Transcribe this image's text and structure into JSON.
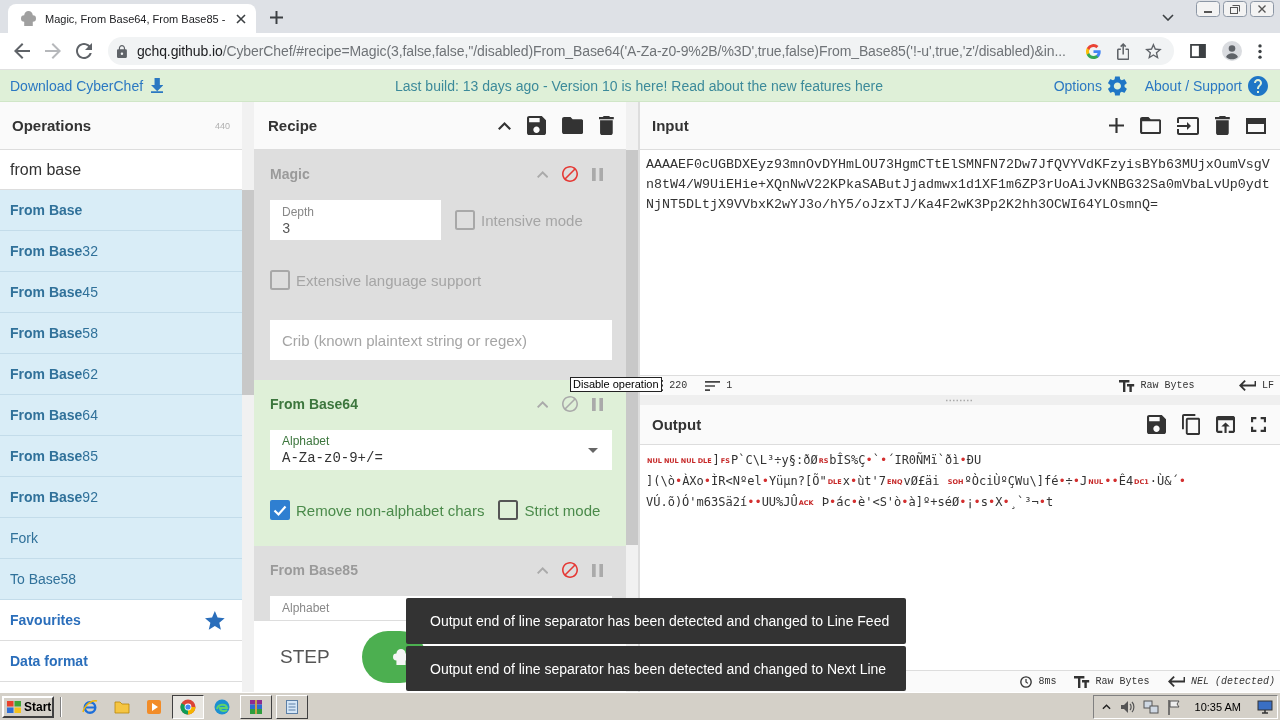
{
  "browser": {
    "tabs": [
      {
        "title": "Magic, From Base64, From Base85 -",
        "selected": true
      }
    ],
    "url": {
      "host": "gchq.github.io",
      "path": "/CyberChef/#recipe=Magic(3,false,false,''/disabled)From_Base64('A-Za-z0-9%2B/%3D',true,false)From_Base85('!-u',true,'z'/disabled)&in..."
    }
  },
  "banner": {
    "download": "Download CyberChef",
    "notice": "Last build: 13 days ago - Version 10 is here! Read about the new features here",
    "options": "Options",
    "about": "About / Support"
  },
  "operations": {
    "title": "Operations",
    "count": "440",
    "search": "from base",
    "items": [
      {
        "bold_part": "From Base"
      },
      {
        "bold_part": "From Base",
        "plain_part": "32"
      },
      {
        "bold_part": "From Base",
        "plain_part": "45"
      },
      {
        "bold_part": "From Base",
        "plain_part": "58"
      },
      {
        "bold_part": "From Base",
        "plain_part": "62"
      },
      {
        "bold_part": "From Base",
        "plain_part": "64"
      },
      {
        "bold_part": "From Base",
        "plain_part": "85"
      },
      {
        "bold_part": "From Base",
        "plain_part": "92"
      },
      {
        "plain_part": "Fork"
      },
      {
        "plain_part": "To Base58"
      }
    ],
    "categories": [
      {
        "label": "Favourites",
        "kind": "favourites"
      },
      {
        "label": "Data format",
        "kind": "category"
      }
    ]
  },
  "recipe": {
    "title": "Recipe",
    "operations": [
      {
        "name": "Magic",
        "disabled": true,
        "args": [
          {
            "kind": "number",
            "label": "Depth",
            "value": "3"
          },
          {
            "kind": "checkbox",
            "label": "Intensive mode",
            "checked": false
          },
          {
            "kind": "checkbox",
            "label": "Extensive language support",
            "checked": false
          },
          {
            "kind": "text",
            "placeholder": "Crib (known plaintext string or regex)"
          }
        ]
      },
      {
        "name": "From Base64",
        "disabled": false,
        "args": [
          {
            "kind": "dropdown",
            "label": "Alphabet",
            "value": "A-Za-z0-9+/="
          },
          {
            "kind": "checkbox",
            "label": "Remove non-alphabet chars",
            "checked": true
          },
          {
            "kind": "checkbox",
            "label": "Strict mode",
            "checked": false
          }
        ]
      },
      {
        "name": "From Base85",
        "disabled": true,
        "args": [
          {
            "kind": "text",
            "label": "Alphabet"
          }
        ]
      }
    ],
    "step": "STEP"
  },
  "tooltip": "Disable operation",
  "input": {
    "title": "Input",
    "value": "AAAAEF0cUGBDXEyz93mnOvDYHmLOU73HgmCTtElSMNFN72Dw7JfQVYVdKFzyisBYb63MUjxOumVsgVn8tW4/W9UiEHie+XQnNwV22KPkaSAButJjadmwx1d1XF1m6ZP3rUoAiJvKNBG32Sa0mVbaLvUp0ydtNjNT5DLtjX9VVbxK2wYJ3o/hY5/oJzxTJ/Ka4F2wK3Pp2K2hh3OCWI64YLOsmnQ=",
    "length": "220",
    "lines": "1",
    "encoding": "Raw Bytes",
    "eol": "LF"
  },
  "output": {
    "title": "Output",
    "lines": [
      [
        {
          "kind": "control",
          "text": "NUL"
        },
        {
          "kind": "control",
          "text": "NUL"
        },
        {
          "kind": "control",
          "text": "NUL"
        },
        {
          "kind": "control",
          "text": "DLE"
        },
        {
          "kind": "text",
          "text": "]"
        },
        {
          "kind": "control",
          "text": "FS"
        },
        {
          "kind": "text",
          "text": "P`C\\L³÷y§:ðØ"
        },
        {
          "kind": "control",
          "text": "RS"
        },
        {
          "kind": "text",
          "text": "bÎS%Ç"
        },
        {
          "kind": "special",
          "text": "•"
        },
        {
          "kind": "text",
          "text": "`"
        },
        {
          "kind": "special",
          "text": "•"
        },
        {
          "kind": "text",
          "text": "´IR0ÑMï`ðì"
        },
        {
          "kind": "special",
          "text": "•"
        },
        {
          "kind": "text",
          "text": "ÐU"
        }
      ],
      [
        {
          "kind": "text",
          "text": "](\\ò"
        },
        {
          "kind": "special",
          "text": "•"
        },
        {
          "kind": "text",
          "text": "ÀXo"
        },
        {
          "kind": "special",
          "text": "•"
        },
        {
          "kind": "text",
          "text": "ÌR<Nºel"
        },
        {
          "kind": "special",
          "text": "•"
        },
        {
          "kind": "text",
          "text": "Yüµn?[Õ\""
        },
        {
          "kind": "control",
          "text": "DLE"
        },
        {
          "kind": "text",
          "text": "x"
        },
        {
          "kind": "special",
          "text": "•"
        },
        {
          "kind": "text",
          "text": "ùt'7"
        },
        {
          "kind": "control",
          "text": "ENQ"
        },
        {
          "kind": "text",
          "text": "vØ£äi "
        },
        {
          "kind": "control",
          "text": "SOH"
        },
        {
          "kind": "text",
          "text": "ºÒciÙºÇWu\\]fé"
        },
        {
          "kind": "special",
          "text": "•"
        },
        {
          "kind": "text",
          "text": "÷"
        },
        {
          "kind": "special",
          "text": "•"
        },
        {
          "kind": "text",
          "text": "J"
        },
        {
          "kind": "control",
          "text": "NUL"
        },
        {
          "kind": "special",
          "text": "•"
        },
        {
          "kind": "special",
          "text": "•"
        },
        {
          "kind": "text",
          "text": "Ê4"
        },
        {
          "kind": "control",
          "text": "DC1"
        },
        {
          "kind": "text",
          "text": "·Ù&´"
        },
        {
          "kind": "special",
          "text": "•"
        }
      ],
      [
        {
          "kind": "text",
          "text": "VÚ.õ)Ó'm63Sä2í"
        },
        {
          "kind": "special",
          "text": "•"
        },
        {
          "kind": "special",
          "text": "•"
        },
        {
          "kind": "text",
          "text": "UU%JÛ"
        },
        {
          "kind": "control",
          "text": "ACK"
        },
        {
          "kind": "text",
          "text": " Þ"
        },
        {
          "kind": "special",
          "text": "•"
        },
        {
          "kind": "text",
          "text": "ác"
        },
        {
          "kind": "special",
          "text": "•"
        },
        {
          "kind": "text",
          "text": "è'<S'ò"
        },
        {
          "kind": "special",
          "text": "•"
        },
        {
          "kind": "text",
          "text": "à]º+séØ"
        },
        {
          "kind": "special",
          "text": "•"
        },
        {
          "kind": "text",
          "text": "¡"
        },
        {
          "kind": "special",
          "text": "•"
        },
        {
          "kind": "text",
          "text": "s"
        },
        {
          "kind": "special",
          "text": "•"
        },
        {
          "kind": "text",
          "text": "X"
        },
        {
          "kind": "special",
          "text": "•"
        },
        {
          "kind": "text",
          "text": "¸`³¬"
        },
        {
          "kind": "special",
          "text": "•"
        },
        {
          "kind": "text",
          "text": "t"
        }
      ]
    ],
    "time": "8ms",
    "encoding": "Raw Bytes",
    "eol": "NEL (detected)"
  },
  "toasts": [
    "Output end of line separator has been detected and changed to Line Feed",
    "Output end of line separator has been detected and changed to Next Line"
  ],
  "taskbar": {
    "start": "Start",
    "apps": [
      {
        "kind": "launcher",
        "selected": false
      },
      {
        "kind": "launcher",
        "selected": false
      },
      {
        "kind": "launcher",
        "selected": false
      },
      {
        "kind": "task",
        "selected": true
      },
      {
        "kind": "launcher",
        "selected": false
      },
      {
        "kind": "task",
        "selected": false
      },
      {
        "kind": "task",
        "selected": false
      }
    ],
    "clock": "10:35 AM"
  }
}
